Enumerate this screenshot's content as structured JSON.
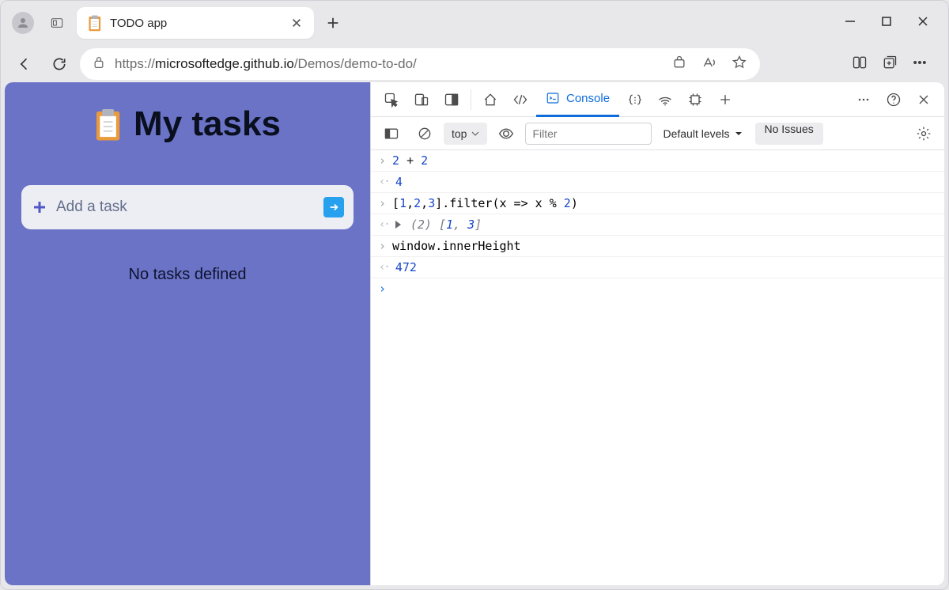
{
  "tab": {
    "title": "TODO app"
  },
  "url": {
    "scheme": "https://",
    "host": "microsoftedge.github.io",
    "path": "/Demos/demo-to-do/"
  },
  "page": {
    "heading": "My tasks",
    "input_placeholder": "Add a task",
    "empty_text": "No tasks defined"
  },
  "devtools": {
    "console_tab": "Console",
    "context": "top",
    "filter_placeholder": "Filter",
    "levels_label": "Default levels",
    "issues_label": "No Issues",
    "lines": {
      "l0_in_a": "2",
      "l0_in_op": " + ",
      "l0_in_b": "2",
      "l1_out": "4",
      "l2_in_pre": "[",
      "l2_in_n1": "1",
      "l2_in_c1": ",",
      "l2_in_n2": "2",
      "l2_in_c2": ",",
      "l2_in_n3": "3",
      "l2_in_post": "].filter(x => x % ",
      "l2_in_n4": "2",
      "l2_in_end": ")",
      "l3_out_cnt": "(2) ",
      "l3_out_arr_open": "[",
      "l3_out_v1": "1",
      "l3_out_c": ", ",
      "l3_out_v2": "3",
      "l3_out_close": "]",
      "l4_in": "window.innerHeight",
      "l5_out": "472"
    }
  }
}
